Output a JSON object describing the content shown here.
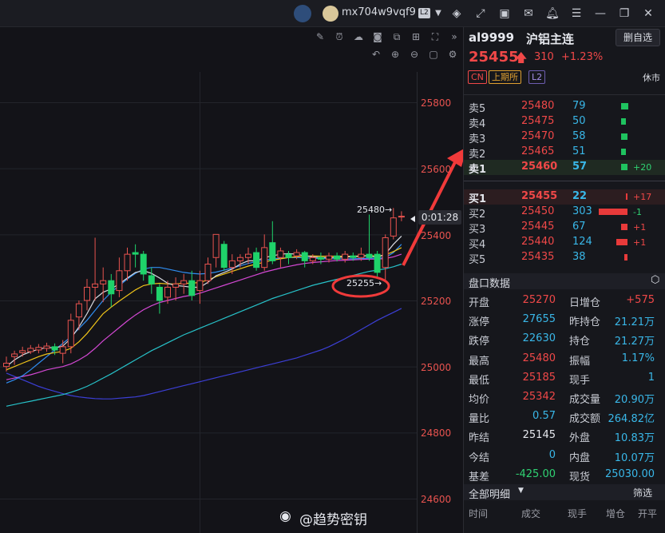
{
  "topbar": {
    "user_name": "mx704w9vqf9",
    "level_badge": "L2",
    "icons": [
      "bot-icon",
      "avatar-icon",
      "layers-icon",
      "expand-icon",
      "video-icon",
      "mail-icon",
      "bell-icon",
      "menu-icon",
      "minimize-icon",
      "restore-icon",
      "close-icon"
    ]
  },
  "chart": {
    "price_axis": [
      "25800",
      "25600",
      "25400",
      "25200",
      "25000",
      "24800",
      "24600"
    ],
    "high_label": "25480→",
    "low_label": "25255→",
    "countdown": "0:01:28",
    "colors": {
      "up": "#e8534f",
      "down": "#1fd36a",
      "ma_white": "#d8dbe2",
      "ma_yellow": "#f0c419",
      "ma_magenta": "#d448d4",
      "ma_cyan": "#27c2c9",
      "ma_blue": "#3c3fd6",
      "ma_lightblue": "#2f8df0"
    },
    "candles": [
      {
        "o": 25000,
        "c": 25010,
        "h": 25030,
        "l": 24985
      },
      {
        "o": 25030,
        "c": 25038,
        "h": 25048,
        "l": 25005
      },
      {
        "o": 25042,
        "c": 25048,
        "h": 25060,
        "l": 25030
      },
      {
        "o": 25045,
        "c": 25055,
        "h": 25065,
        "l": 25038
      },
      {
        "o": 25050,
        "c": 25058,
        "h": 25068,
        "l": 25040
      },
      {
        "o": 25055,
        "c": 25062,
        "h": 25072,
        "l": 25045
      },
      {
        "o": 25060,
        "c": 25050,
        "h": 25070,
        "l": 25035
      },
      {
        "o": 25040,
        "c": 25060,
        "h": 25080,
        "l": 25010
      },
      {
        "o": 25060,
        "c": 25140,
        "h": 25160,
        "l": 25040
      },
      {
        "o": 25150,
        "c": 25190,
        "h": 25200,
        "l": 25110
      },
      {
        "o": 25200,
        "c": 25240,
        "h": 25265,
        "l": 25170
      },
      {
        "o": 25240,
        "c": 25250,
        "h": 25390,
        "l": 25200
      },
      {
        "o": 25250,
        "c": 25260,
        "h": 25300,
        "l": 25195
      },
      {
        "o": 25260,
        "c": 25220,
        "h": 25280,
        "l": 25180
      },
      {
        "o": 25230,
        "c": 25290,
        "h": 25330,
        "l": 25210
      },
      {
        "o": 25290,
        "c": 25340,
        "h": 25360,
        "l": 25260
      },
      {
        "o": 25345,
        "c": 25340,
        "h": 25370,
        "l": 25300
      },
      {
        "o": 25340,
        "c": 25280,
        "h": 25350,
        "l": 25260
      },
      {
        "o": 25275,
        "c": 25250,
        "h": 25300,
        "l": 25220
      },
      {
        "o": 25240,
        "c": 25200,
        "h": 25250,
        "l": 25160
      },
      {
        "o": 25210,
        "c": 25240,
        "h": 25260,
        "l": 25190
      },
      {
        "o": 25240,
        "c": 25250,
        "h": 25270,
        "l": 25200
      },
      {
        "o": 25250,
        "c": 25260,
        "h": 25280,
        "l": 25220
      },
      {
        "o": 25260,
        "c": 25215,
        "h": 25290,
        "l": 25200
      },
      {
        "o": 25230,
        "c": 25260,
        "h": 25290,
        "l": 25190
      },
      {
        "o": 25260,
        "c": 25310,
        "h": 25330,
        "l": 25250
      },
      {
        "o": 25330,
        "c": 25400,
        "h": 25400,
        "l": 25300
      },
      {
        "o": 25370,
        "c": 25300,
        "h": 25380,
        "l": 25290
      },
      {
        "o": 25300,
        "c": 25320,
        "h": 25340,
        "l": 25280
      },
      {
        "o": 25320,
        "c": 25330,
        "h": 25340,
        "l": 25300
      },
      {
        "o": 25330,
        "c": 25340,
        "h": 25360,
        "l": 25310
      },
      {
        "o": 25345,
        "c": 25300,
        "h": 25360,
        "l": 25290
      },
      {
        "o": 25300,
        "c": 25360,
        "h": 25400,
        "l": 25290
      },
      {
        "o": 25375,
        "c": 25320,
        "h": 25440,
        "l": 25310
      },
      {
        "o": 25330,
        "c": 25350,
        "h": 25360,
        "l": 25300
      },
      {
        "o": 25340,
        "c": 25330,
        "h": 25350,
        "l": 25310
      },
      {
        "o": 25335,
        "c": 25345,
        "h": 25355,
        "l": 25325
      },
      {
        "o": 25345,
        "c": 25320,
        "h": 25350,
        "l": 25300
      },
      {
        "o": 25320,
        "c": 25330,
        "h": 25340,
        "l": 25310
      },
      {
        "o": 25330,
        "c": 25325,
        "h": 25345,
        "l": 25310
      },
      {
        "o": 25325,
        "c": 25335,
        "h": 25345,
        "l": 25315
      },
      {
        "o": 25335,
        "c": 25325,
        "h": 25345,
        "l": 25318
      },
      {
        "o": 25325,
        "c": 25340,
        "h": 25350,
        "l": 25315
      },
      {
        "o": 25335,
        "c": 25330,
        "h": 25345,
        "l": 25320
      },
      {
        "o": 25330,
        "c": 25340,
        "h": 25360,
        "l": 25320
      },
      {
        "o": 25340,
        "c": 25330,
        "h": 25460,
        "l": 25320
      },
      {
        "o": 25340,
        "c": 25285,
        "h": 25350,
        "l": 25270
      },
      {
        "o": 25300,
        "c": 25390,
        "h": 25400,
        "l": 25255
      },
      {
        "o": 25395,
        "c": 25450,
        "h": 25480,
        "l": 25385
      },
      {
        "o": 25455,
        "c": 25455,
        "h": 25470,
        "l": 25440
      }
    ],
    "ma_lines": {
      "ma_white": [
        25000,
        25020,
        25035,
        25045,
        25052,
        25058,
        25056,
        25062,
        25085,
        25120,
        25160,
        25205,
        25225,
        25235,
        25250,
        25268,
        25285,
        25290,
        25282,
        25268,
        25252,
        25245,
        25243,
        25240,
        25240,
        25255,
        25275,
        25285,
        25295,
        25310,
        25320,
        25320,
        25330,
        25335,
        25340,
        25342,
        25340,
        25335,
        25332,
        25330,
        25330,
        25330,
        25332,
        25332,
        25334,
        25336,
        25330,
        25340,
        25370,
        25395
      ],
      "ma_yellow": [
        24990,
        25000,
        25010,
        25020,
        25030,
        25038,
        25042,
        25046,
        25055,
        25075,
        25100,
        25130,
        25160,
        25180,
        25198,
        25215,
        25232,
        25245,
        25250,
        25252,
        25250,
        25250,
        25252,
        25252,
        25255,
        25262,
        25272,
        25280,
        25288,
        25296,
        25304,
        25310,
        25316,
        25322,
        25326,
        25330,
        25332,
        25334,
        25335,
        25334,
        25334,
        25334,
        25334,
        25334,
        25335,
        25336,
        25334,
        25338,
        25348,
        25360
      ],
      "ma_magenta": [
        24960,
        24965,
        24970,
        24975,
        24982,
        24990,
        24995,
        25000,
        25008,
        25020,
        25035,
        25055,
        25078,
        25098,
        25118,
        25138,
        25156,
        25172,
        25184,
        25194,
        25200,
        25206,
        25212,
        25216,
        25222,
        25230,
        25238,
        25246,
        25254,
        25262,
        25270,
        25278,
        25286,
        25292,
        25298,
        25303,
        25308,
        25312,
        25315,
        25317,
        25319,
        25321,
        25322,
        25323,
        25324,
        25325,
        25325,
        25327,
        25332,
        25340
      ],
      "ma_cyan": [
        24880,
        24885,
        24890,
        24895,
        24900,
        24905,
        24910,
        24915,
        24922,
        24930,
        24940,
        24952,
        24965,
        24978,
        24992,
        25006,
        25020,
        25034,
        25048,
        25060,
        25072,
        25084,
        25096,
        25106,
        25116,
        25126,
        25136,
        25146,
        25156,
        25166,
        25176,
        25186,
        25196,
        25206,
        25214,
        25222,
        25230,
        25238,
        25246,
        25252,
        25258,
        25264,
        25270,
        25276,
        25282,
        25288,
        25292,
        25296,
        25302,
        25310
      ],
      "ma_blue": [
        24980,
        24970,
        24960,
        24950,
        24940,
        24932,
        24925,
        24918,
        24912,
        24908,
        24905,
        24903,
        24902,
        24902,
        24904,
        24906,
        24908,
        24912,
        24918,
        24924,
        24930,
        24936,
        24942,
        24948,
        24954,
        24960,
        24966,
        24972,
        24978,
        24984,
        24990,
        24996,
        25002,
        25008,
        25014,
        25020,
        25026,
        25034,
        25042,
        25050,
        25060,
        25072,
        25084,
        25098,
        25112,
        25126,
        25140,
        25152,
        25164,
        25176
      ],
      "ma_lightblue": [
        24950,
        24960,
        24972,
        24990,
        25010,
        25030,
        25050,
        25070,
        25090,
        25115,
        25140,
        25170,
        25200,
        25225,
        25245,
        25265,
        25282,
        25295,
        25300,
        25300,
        25295,
        25290,
        25285,
        25282,
        25280,
        25282,
        25286,
        25292,
        25298,
        25305,
        25312,
        25318,
        25322,
        25326,
        25328,
        25330,
        25330,
        25329,
        25328,
        25327,
        25326,
        25326,
        25326,
        25326,
        25327,
        25328,
        25328,
        25330,
        25345,
        25370
      ]
    }
  },
  "panel": {
    "symbol_code": "al9999",
    "symbol_name": "沪铝主连",
    "delete_label": "删自选",
    "last_price": "25455",
    "change": "310",
    "change_pct": "+1.23%",
    "tag_cn": "CN",
    "tag_exchange": "上期所",
    "tag_level": "L2",
    "market_status": "休市",
    "asks": [
      {
        "label": "卖5",
        "price": "25480",
        "vol": "79",
        "delta": "",
        "bar": 6
      },
      {
        "label": "卖4",
        "price": "25475",
        "vol": "50",
        "delta": "",
        "bar": 4
      },
      {
        "label": "卖3",
        "price": "25470",
        "vol": "58",
        "delta": "",
        "bar": 5
      },
      {
        "label": "卖2",
        "price": "25465",
        "vol": "51",
        "delta": "",
        "bar": 4
      },
      {
        "label": "卖1",
        "price": "25460",
        "vol": "57",
        "delta": "+20",
        "bar": 5
      }
    ],
    "bids": [
      {
        "label": "买1",
        "price": "25455",
        "vol": "22",
        "delta": "+17",
        "bar": 2,
        "dir": "red"
      },
      {
        "label": "买2",
        "price": "25450",
        "vol": "303",
        "delta": "-1",
        "bar": 36,
        "dir": "red"
      },
      {
        "label": "买3",
        "price": "25445",
        "vol": "67",
        "delta": "+1",
        "bar": 8,
        "dir": "red"
      },
      {
        "label": "买4",
        "price": "25440",
        "vol": "124",
        "delta": "+1",
        "bar": 14,
        "dir": "red"
      },
      {
        "label": "买5",
        "price": "25435",
        "vol": "38",
        "delta": "",
        "bar": 4,
        "dir": "red"
      }
    ],
    "stats_title": "盘口数据",
    "stats": [
      {
        "l1": "开盘",
        "v1": "25270",
        "c1": "red",
        "l2": "日增仓",
        "v2": "+575",
        "c2": "red"
      },
      {
        "l1": "涨停",
        "v1": "27655",
        "c1": "cyan",
        "l2": "昨持仓",
        "v2": "21.21万",
        "c2": "cyan"
      },
      {
        "l1": "跌停",
        "v1": "22630",
        "c1": "cyan",
        "l2": "持仓",
        "v2": "21.27万",
        "c2": "cyan"
      },
      {
        "l1": "最高",
        "v1": "25480",
        "c1": "red",
        "l2": "振幅",
        "v2": "1.17%",
        "c2": "cyan"
      },
      {
        "l1": "最低",
        "v1": "25185",
        "c1": "red",
        "l2": "现手",
        "v2": "1",
        "c2": "cyan"
      },
      {
        "l1": "均价",
        "v1": "25342",
        "c1": "red",
        "l2": "成交量",
        "v2": "20.90万",
        "c2": "cyan"
      },
      {
        "l1": "量比",
        "v1": "0.57",
        "c1": "cyan",
        "l2": "成交额",
        "v2": "264.82亿",
        "c2": "cyan"
      },
      {
        "l1": "昨结",
        "v1": "25145",
        "c1": "white",
        "l2": "外盘",
        "v2": "10.83万",
        "c2": "cyan"
      },
      {
        "l1": "今结",
        "v1": "0",
        "c1": "cyan",
        "l2": "内盘",
        "v2": "10.07万",
        "c2": "cyan"
      },
      {
        "l1": "基差",
        "v1": "-425.00",
        "c1": "green",
        "l2": "现货",
        "v2": "25030.00",
        "c2": "cyan"
      }
    ],
    "detail_title": "全部明细",
    "filter_label": "筛选",
    "detail_headers": [
      "时间",
      "成交",
      "现手",
      "增仓",
      "开平"
    ]
  },
  "watermark": "@趋势密钥"
}
